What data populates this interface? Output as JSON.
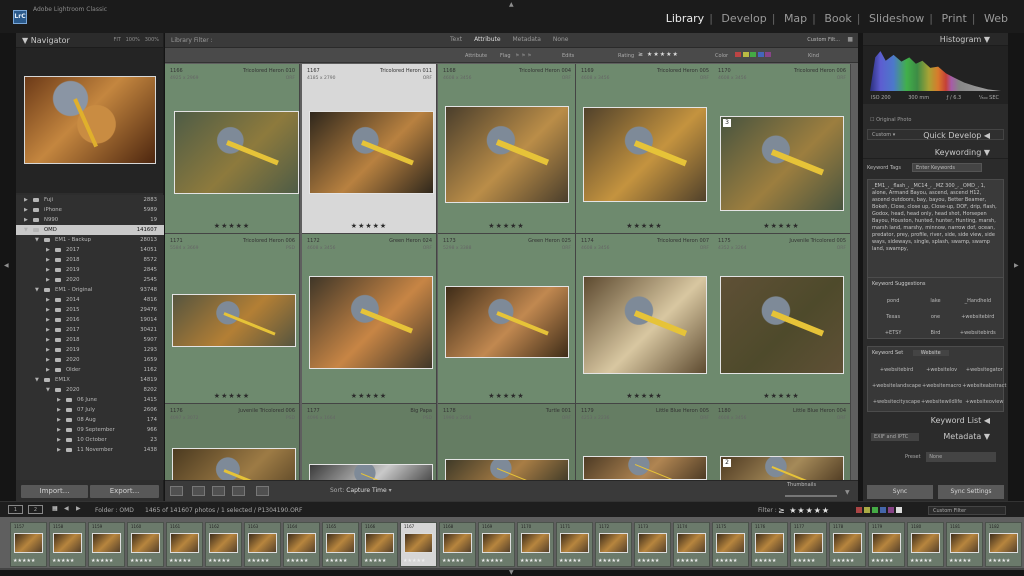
{
  "app": {
    "name": "Adobe Lightroom Classic",
    "logo": "LrC"
  },
  "modules": [
    "Library",
    "Develop",
    "Map",
    "Book",
    "Slideshow",
    "Print",
    "Web"
  ],
  "left_panel": {
    "title": "Navigator",
    "zoom": [
      "FIT",
      "100%",
      "300%"
    ],
    "folders": [
      {
        "name": "Fuji",
        "count": "2883",
        "level": 1,
        "expanded": false
      },
      {
        "name": "iPhone",
        "count": "5989",
        "level": 1,
        "expanded": false
      },
      {
        "name": "N990",
        "count": "19",
        "level": 1,
        "expanded": false
      },
      {
        "name": "OMD",
        "count": "141607",
        "level": 1,
        "expanded": true,
        "selected": true
      },
      {
        "name": "EM1 - Backup",
        "count": "28013",
        "level": 2,
        "expanded": true
      },
      {
        "name": "2017",
        "count": "14051",
        "level": 3,
        "expanded": false
      },
      {
        "name": "2018",
        "count": "8572",
        "level": 3,
        "expanded": false
      },
      {
        "name": "2019",
        "count": "2845",
        "level": 3,
        "expanded": false
      },
      {
        "name": "2020",
        "count": "2545",
        "level": 3,
        "expanded": false
      },
      {
        "name": "EM1 - Original",
        "count": "93748",
        "level": 2,
        "expanded": true
      },
      {
        "name": "2014",
        "count": "4816",
        "level": 3,
        "expanded": false
      },
      {
        "name": "2015",
        "count": "29476",
        "level": 3,
        "expanded": false
      },
      {
        "name": "2016",
        "count": "19014",
        "level": 3,
        "expanded": false
      },
      {
        "name": "2017",
        "count": "30421",
        "level": 3,
        "expanded": false
      },
      {
        "name": "2018",
        "count": "5907",
        "level": 3,
        "expanded": false
      },
      {
        "name": "2019",
        "count": "1293",
        "level": 3,
        "expanded": false
      },
      {
        "name": "2020",
        "count": "1659",
        "level": 3,
        "expanded": false
      },
      {
        "name": "Older",
        "count": "1162",
        "level": 3,
        "expanded": false
      },
      {
        "name": "EM1X",
        "count": "14819",
        "level": 2,
        "expanded": true
      },
      {
        "name": "2020",
        "count": "8202",
        "level": 3,
        "expanded": true
      },
      {
        "name": "06 June",
        "count": "1415",
        "level": 4,
        "expanded": false
      },
      {
        "name": "07 July",
        "count": "2606",
        "level": 4,
        "expanded": false
      },
      {
        "name": "08 Aug",
        "count": "174",
        "level": 4,
        "expanded": false
      },
      {
        "name": "09 September",
        "count": "966",
        "level": 4,
        "expanded": false
      },
      {
        "name": "10 October",
        "count": "23",
        "level": 4,
        "expanded": false
      },
      {
        "name": "11 November",
        "count": "1438",
        "level": 4,
        "expanded": false
      }
    ],
    "import_label": "Import...",
    "export_label": "Export..."
  },
  "filter": {
    "title": "Library Filter :",
    "tabs": [
      "Text",
      "Attribute",
      "Metadata",
      "None"
    ],
    "active_tab": "Attribute",
    "custom_label": "Custom Filt...",
    "attribute_row": {
      "label": "Attribute",
      "flag": "Flag",
      "edits": "Edits",
      "rating": "Rating",
      "rating_stars": "≥ ★★★★★",
      "color": "Color",
      "kind": "Kind"
    }
  },
  "grid": {
    "cells": [
      {
        "num": "1166",
        "dims": "4925 x 2969",
        "title": "Tricolored Heron 010",
        "ext": "ORF",
        "rating": "★★★★★",
        "badge": ""
      },
      {
        "num": "1167",
        "dims": "4185 x 2790",
        "title": "Tricolored Heron 011",
        "ext": "ORF",
        "rating": "★★★★★",
        "badge": "",
        "selected": true
      },
      {
        "num": "1168",
        "dims": "4608 x 3456",
        "title": "Tricolored Heron 004",
        "ext": "ORF",
        "rating": "★★★★★",
        "badge": ""
      },
      {
        "num": "1169",
        "dims": "4608 x 3456",
        "title": "Tricolored Heron 005",
        "ext": "ORF",
        "rating": "★★★★★",
        "badge": ""
      },
      {
        "num": "1170",
        "dims": "4608 x 3456",
        "title": "Tricolored Heron 006",
        "ext": "ORF",
        "rating": "★★★★★",
        "badge": "3"
      },
      {
        "num": "1171",
        "dims": "5584 x 3669",
        "title": "Tricolored Heron 006",
        "ext": "PSD",
        "rating": "★★★★★",
        "badge": ""
      },
      {
        "num": "1172",
        "dims": "4608 x 3456",
        "title": "Green Heron 024",
        "ext": "ORF",
        "rating": "★★★★★",
        "badge": ""
      },
      {
        "num": "1173",
        "dims": "5298 x 3388",
        "title": "Green Heron 025",
        "ext": "ORF",
        "rating": "★★★★★",
        "badge": ""
      },
      {
        "num": "1174",
        "dims": "4608 x 3456",
        "title": "Tricolored Heron 007",
        "ext": "ORF",
        "rating": "★★★★★",
        "badge": ""
      },
      {
        "num": "1175",
        "dims": "4352 x 3264",
        "title": "Juvenile Tricolored 005",
        "ext": "ORF",
        "rating": "★★★★★",
        "badge": ""
      },
      {
        "num": "1176",
        "dims": "4097 x 3072",
        "title": "Juvenile Tricolored 006",
        "ext": "PSD",
        "rating": "",
        "badge": ""
      },
      {
        "num": "1177",
        "dims": "4096 x 1664",
        "title": "Big Papa",
        "ext": "PSD",
        "rating": "",
        "badge": ""
      },
      {
        "num": "1178",
        "dims": "1990 x 2058",
        "title": "Turtle 001",
        "ext": "ORF",
        "rating": "",
        "badge": ""
      },
      {
        "num": "1179",
        "dims": "4253 x 2236",
        "title": "Little Blue Heron 005",
        "ext": "ORF",
        "rating": "",
        "badge": ""
      },
      {
        "num": "1180",
        "dims": "4608 x 3456",
        "title": "Little Blue Heron 004",
        "ext": "ORF",
        "rating": "",
        "badge": "2"
      }
    ]
  },
  "toolbar": {
    "sort": "Sort:",
    "sort_value": "Capture Time",
    "thumbnails": "Thumbnails"
  },
  "right_panel": {
    "histogram": "Histogram",
    "iso": "ISO 200",
    "focal": "300 mm",
    "aperture": "ƒ / 6.3",
    "shutter": "¹⁄₈₀₀ SEC",
    "original_photo": "Original Photo",
    "quick_develop": "Quick Develop",
    "custom": "Custom",
    "keywording": "Keywording",
    "keyword_tags_label": "Keyword Tags",
    "keyword_tags_value": "Enter Keywords",
    "keywords_text": "_EM1_, _flash_, _MC14_, _MZ 300_, _OMD_, 1, alone, Armand Bayou, ascend, ascend H12, ascend outdoors, bay, bayou, Better Beamer, Bokeh, Close, close up, Close-up, DOF, drip, flash, Godox, head, head only, head shot, Horsepen Bayou, Houston, hunted, hunter, Hunting, marsh, marsh land, marshy, minnow, narrow dof, ocean, predator, prey, profile, river, side, side view, side ways, sideways, single, splash, swamp, swamp land, swampy,",
    "keyword_suggestions": "Keyword Suggestions",
    "suggestions": [
      "pond",
      "lake",
      "_Handheld",
      "Texas",
      "one",
      "+websitebird",
      "+ETSY",
      "Bird",
      "+websitebirds"
    ],
    "keyword_set_label": "Keyword Set",
    "keyword_set_value": "Website",
    "set_items": [
      "+websitebird",
      "+websitelov",
      "+websitegator",
      "+websitelandscape",
      "+websitemacro",
      "+websiteabstract",
      "+websitecityscape",
      "+websitewildlife",
      "+websiteoview"
    ],
    "keyword_list": "Keyword List",
    "metadata": "Metadata",
    "metadata_preset": "EXIF and IPTC",
    "preset_label": "Preset",
    "preset_value": "None",
    "sync": "Sync",
    "sync_settings": "Sync Settings"
  },
  "filmbar": {
    "path": "Folder : OMD",
    "count": "1465 of 141607 photos / 1 selected / P1304190.ORF",
    "filter": "Filter :",
    "filter_stars": "≥ ★★★★★",
    "custom": "Custom Filter"
  },
  "filmstrip": {
    "tiles": [
      {
        "n": "1157"
      },
      {
        "n": "1158"
      },
      {
        "n": "1159"
      },
      {
        "n": "1160"
      },
      {
        "n": "1161"
      },
      {
        "n": "1162"
      },
      {
        "n": "1163"
      },
      {
        "n": "1164"
      },
      {
        "n": "1165"
      },
      {
        "n": "1166"
      },
      {
        "n": "1167",
        "selected": true
      },
      {
        "n": "1168"
      },
      {
        "n": "1169"
      },
      {
        "n": "1170"
      },
      {
        "n": "1171"
      },
      {
        "n": "1172"
      },
      {
        "n": "1173"
      },
      {
        "n": "1174"
      },
      {
        "n": "1175"
      },
      {
        "n": "1176"
      },
      {
        "n": "1177"
      },
      {
        "n": "1178"
      },
      {
        "n": "1179"
      },
      {
        "n": "1180"
      },
      {
        "n": "1181"
      },
      {
        "n": "1182"
      }
    ],
    "rating": "★★★★★"
  }
}
